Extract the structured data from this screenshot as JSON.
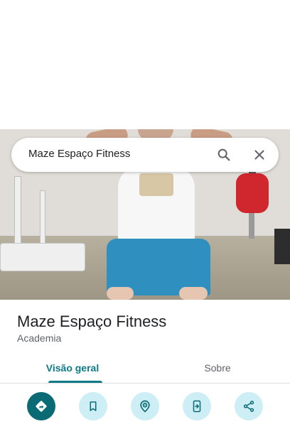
{
  "search": {
    "query": "Maze Espaço Fitness"
  },
  "icons": {
    "search": "search-icon",
    "close": "close-icon",
    "directions": "directions-icon",
    "save": "bookmark-icon",
    "nearby": "nearby-location-icon",
    "send_to_phone": "send-to-phone-icon",
    "share": "share-icon"
  },
  "place": {
    "name": "Maze Espaço Fitness",
    "category": "Academia"
  },
  "tabs": [
    {
      "label": "Visão geral",
      "active": true
    },
    {
      "label": "Sobre",
      "active": false
    }
  ],
  "colors": {
    "accent": "#0b7a86",
    "primary_action": "#0b6b74",
    "secondary_action": "#cdeef5"
  }
}
